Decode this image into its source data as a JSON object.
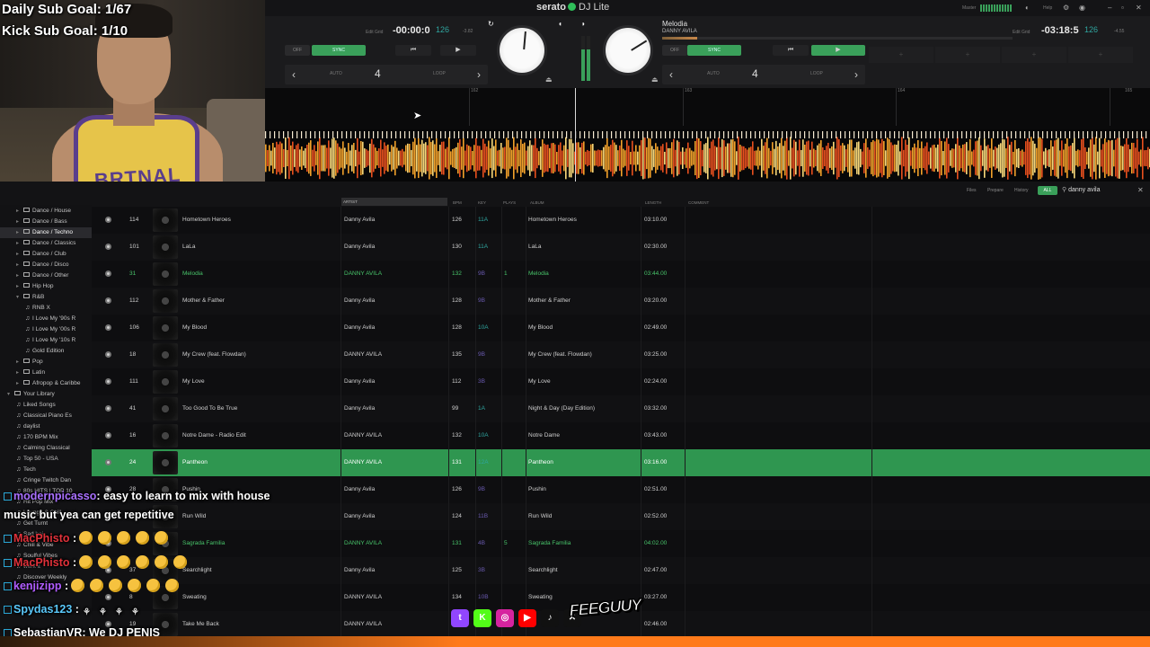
{
  "overlay": {
    "daily_goal": "Daily Sub Goal: 1/67",
    "kick_goal": "Kick Sub Goal: 1/10",
    "jersey_text": "BRTNAL"
  },
  "app": {
    "logo": "serato",
    "logo_suffix": "DJ Lite",
    "master_label": "Master",
    "help_label": "Help",
    "window_controls": [
      "minimize-icon",
      "maximize-icon",
      "close-icon"
    ]
  },
  "deck_a": {
    "edit_grid": "Edit Grid",
    "time": "-00:00:0",
    "bpm": "126",
    "bpm_offset": "-3.82",
    "off_label": "OFF",
    "sync_label": "SYNC",
    "auto_label": "AUTO",
    "loop_value": "4",
    "loop_label": "LOOP"
  },
  "deck_b": {
    "title": "Melodia",
    "artist": "DANNY AVILA",
    "edit_grid": "Edit Grid",
    "time": "-03:18:5",
    "bpm": "126",
    "bpm_offset": "-4.55",
    "off_label": "OFF",
    "sync_label": "SYNC",
    "auto_label": "AUTO",
    "loop_value": "4",
    "loop_label": "LOOP",
    "progress": 0.1,
    "hotcues": [
      "+",
      "+",
      "+",
      "+"
    ]
  },
  "overview": {
    "bar_markers": [
      "162",
      "163",
      "164",
      "165"
    ]
  },
  "browser": {
    "columns": {
      "artist": "ARTIST",
      "bpm": "BPM",
      "key": "KEY",
      "plays": "PLAYS",
      "album": "ALBUM",
      "length": "LENGTH",
      "comment": "COMMENT"
    },
    "tabs": {
      "files": "Files",
      "prepare": "Prepare",
      "history": "History",
      "all": "ALL"
    },
    "search_value": "danny avila"
  },
  "sidebar": {
    "items": [
      {
        "label": "Dance / House",
        "type": "folder",
        "indent": 1
      },
      {
        "label": "Dance / Bass",
        "type": "folder",
        "indent": 1
      },
      {
        "label": "Dance / Techno",
        "type": "folder",
        "indent": 1,
        "selected": true
      },
      {
        "label": "Dance / Classics",
        "type": "folder",
        "indent": 1
      },
      {
        "label": "Dance / Club",
        "type": "folder",
        "indent": 1
      },
      {
        "label": "Dance / Disco",
        "type": "folder",
        "indent": 1
      },
      {
        "label": "Dance / Other",
        "type": "folder",
        "indent": 1
      },
      {
        "label": "Hip Hop",
        "type": "folder",
        "indent": 1
      },
      {
        "label": "R&B",
        "type": "folder",
        "indent": 1,
        "open": true
      },
      {
        "label": "RNB X",
        "type": "playlist",
        "indent": 2
      },
      {
        "label": "I Love My '90s R",
        "type": "playlist",
        "indent": 2
      },
      {
        "label": "I Love My '00s R",
        "type": "playlist",
        "indent": 2
      },
      {
        "label": "I Love My '10s R",
        "type": "playlist",
        "indent": 2
      },
      {
        "label": "Gold Edition",
        "type": "playlist",
        "indent": 2
      },
      {
        "label": "Pop",
        "type": "folder",
        "indent": 1
      },
      {
        "label": "Latin",
        "type": "folder",
        "indent": 1
      },
      {
        "label": "Afropop & Caribbe",
        "type": "folder",
        "indent": 1
      },
      {
        "label": "Your Library",
        "type": "folder",
        "indent": 0,
        "open": true
      },
      {
        "label": "Liked Songs",
        "type": "playlist",
        "indent": 1
      },
      {
        "label": "Classical Piano Es",
        "type": "playlist",
        "indent": 1
      },
      {
        "label": "daylist",
        "type": "playlist",
        "indent": 1
      },
      {
        "label": "170 BPM Mix",
        "type": "playlist",
        "indent": 1
      },
      {
        "label": "Calming Classical",
        "type": "playlist",
        "indent": 1
      },
      {
        "label": "Top 50 - USA",
        "type": "playlist",
        "indent": 1
      },
      {
        "label": "Tech",
        "type": "playlist",
        "indent": 1
      },
      {
        "label": "Cringe Twitch Dan",
        "type": "playlist",
        "indent": 1
      },
      {
        "label": "80s HITS | TOP 10",
        "type": "playlist",
        "indent": 1
      },
      {
        "label": "Hit Pop Mix",
        "type": "playlist",
        "indent": 1
      },
      {
        "label": "Lounge & Chill",
        "type": "playlist",
        "indent": 1
      },
      {
        "label": "Get Turnt",
        "type": "playlist",
        "indent": 1
      },
      {
        "label": "Sad boi",
        "type": "playlist",
        "indent": 1
      },
      {
        "label": "Chill & Vibe",
        "type": "playlist",
        "indent": 1
      },
      {
        "label": "Soulful Vibes",
        "type": "playlist",
        "indent": 1
      },
      {
        "label": "werk it",
        "type": "playlist",
        "indent": 1
      },
      {
        "label": "Discover Weekly",
        "type": "playlist",
        "indent": 1
      },
      {
        "label": "Starred",
        "type": "playlist",
        "indent": 1
      }
    ]
  },
  "tracks": [
    {
      "num": "114",
      "title": "Hometown Heroes",
      "artist": "Danny Avila",
      "bpm": "126",
      "key": "11A",
      "plays": "",
      "album": "Hometown Heroes",
      "length": "03:10.00"
    },
    {
      "num": "101",
      "title": "LaLa",
      "artist": "Danny Avila",
      "bpm": "130",
      "key": "11A",
      "plays": "",
      "album": "LaLa",
      "length": "02:30.00"
    },
    {
      "num": "31",
      "title": "Melodia",
      "artist": "DANNY AVILA",
      "bpm": "132",
      "key": "9B",
      "plays": "1",
      "album": "Melodia",
      "length": "03:44.00",
      "state": "playing"
    },
    {
      "num": "112",
      "title": "Mother & Father",
      "artist": "Danny Avila",
      "bpm": "128",
      "key": "9B",
      "plays": "",
      "album": "Mother & Father",
      "length": "03:20.00"
    },
    {
      "num": "106",
      "title": "My Blood",
      "artist": "Danny Avila",
      "bpm": "128",
      "key": "10A",
      "plays": "",
      "album": "My Blood",
      "length": "02:49.00"
    },
    {
      "num": "18",
      "title": "My Crew (feat. Flowdan)",
      "artist": "DANNY AVILA",
      "bpm": "135",
      "key": "9B",
      "plays": "",
      "album": "My Crew (feat. Flowdan)",
      "length": "03:25.00"
    },
    {
      "num": "111",
      "title": "My Love",
      "artist": "Danny Avila",
      "bpm": "112",
      "key": "3B",
      "plays": "",
      "album": "My Love",
      "length": "02:24.00"
    },
    {
      "num": "41",
      "title": "Too Good To Be True",
      "artist": "Danny Avila",
      "bpm": "99",
      "key": "1A",
      "plays": "",
      "album": "Night & Day (Day Edition)",
      "length": "03:32.00"
    },
    {
      "num": "16",
      "title": "Notre Dame - Radio Edit",
      "artist": "DANNY AVILA",
      "bpm": "132",
      "key": "10A",
      "plays": "",
      "album": "Notre Dame",
      "length": "03:43.00"
    },
    {
      "num": "24",
      "title": "Pantheon",
      "artist": "DANNY AVILA",
      "bpm": "131",
      "key": "12A",
      "plays": "",
      "album": "Pantheon",
      "length": "03:16.00",
      "state": "selected"
    },
    {
      "num": "28",
      "title": "Pushin",
      "artist": "Danny Avila",
      "bpm": "126",
      "key": "9B",
      "plays": "",
      "album": "Pushin",
      "length": "02:51.00"
    },
    {
      "num": "",
      "title": "Run Wild",
      "artist": "Danny Avila",
      "bpm": "124",
      "key": "11B",
      "plays": "",
      "album": "Run Wild",
      "length": "02:52.00"
    },
    {
      "num": "",
      "title": "Sagrada Familia",
      "artist": "DANNY AVILA",
      "bpm": "131",
      "key": "4B",
      "plays": "5",
      "album": "Sagrada Familia",
      "length": "04:02.00",
      "state": "playing"
    },
    {
      "num": "37",
      "title": "Searchlight",
      "artist": "Danny Avila",
      "bpm": "125",
      "key": "3B",
      "plays": "",
      "album": "Searchlight",
      "length": "02:47.00"
    },
    {
      "num": "8",
      "title": "Sweating",
      "artist": "DANNY AVILA",
      "bpm": "134",
      "key": "10B",
      "plays": "",
      "album": "Sweating",
      "length": "03:27.00"
    },
    {
      "num": "19",
      "title": "Take Me Back",
      "artist": "DANNY AVILA",
      "bpm": "",
      "key": "",
      "plays": "",
      "album": "",
      "length": "02:46.00"
    }
  ],
  "chat": [
    {
      "user": "modernpicasso",
      "user_color": "#a970ff",
      "text": ": easy to learn to mix with house",
      "emotes": 0
    },
    {
      "user": "",
      "user_color": "#ffffff",
      "text": "music but yea can get repetitive",
      "emotes": 0
    },
    {
      "user": "MacPhisto",
      "user_color": "#e0313a",
      "text": " :",
      "emotes": 5
    },
    {
      "user": "MacPhisto",
      "user_color": "#e0313a",
      "text": " :",
      "emotes": 6
    },
    {
      "user": "kenjizipp",
      "user_color": "#b05cff",
      "text": " :",
      "emotes": 6
    },
    {
      "user": "Spydas123",
      "user_color": "#5ac8fa",
      "text": " :",
      "emotes": 0,
      "sticks": 4
    },
    {
      "user": "SebastianVR",
      "user_color": "#ffffff",
      "text": ": We     DJ PENIS",
      "emotes": 0
    }
  ],
  "socials": [
    {
      "icon": "twitch-icon",
      "color": "#9146ff",
      "glyph": "t"
    },
    {
      "icon": "kick-icon",
      "color": "#53fc18",
      "glyph": "K"
    },
    {
      "icon": "instagram-icon",
      "color": "#d6249f",
      "glyph": "◎"
    },
    {
      "icon": "youtube-icon",
      "color": "#ff0000",
      "glyph": "▶"
    },
    {
      "icon": "tiktok-icon",
      "color": "#111111",
      "glyph": "♪"
    },
    {
      "icon": "x-icon",
      "color": "#111111",
      "glyph": "✕"
    }
  ],
  "brand_tag": "FEEGUUY"
}
